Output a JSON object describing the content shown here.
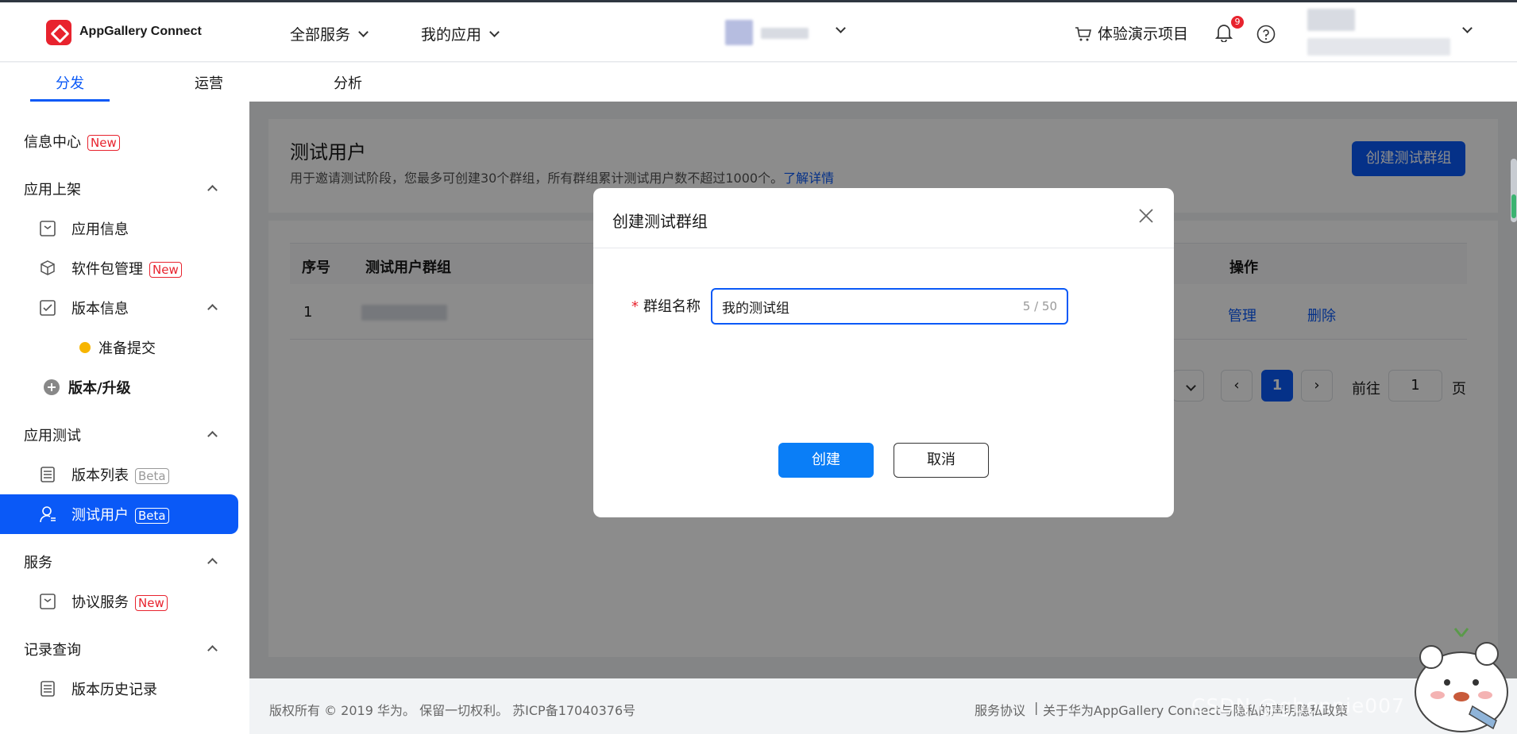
{
  "brand": {
    "name": "AppGallery Connect"
  },
  "topnav": {
    "all_services": "全部服务",
    "my_apps": "我的应用",
    "demo_project": "体验演示项目",
    "notification_count": "9"
  },
  "tabs": [
    {
      "label": "分发"
    },
    {
      "label": "运营"
    },
    {
      "label": "分析"
    }
  ],
  "sidebar": {
    "info_center": "信息中心",
    "info_center_tag": "New",
    "app_listing": "应用上架",
    "app_info": "应用信息",
    "package_mgmt": "软件包管理",
    "package_mgmt_tag": "New",
    "version_info": "版本信息",
    "ready_submit": "准备提交",
    "version_upgrade": "版本/升级",
    "app_test": "应用测试",
    "version_list": "版本列表",
    "version_list_tag": "Beta",
    "test_users": "测试用户",
    "test_users_tag": "Beta",
    "services": "服务",
    "agreement_service": "协议服务",
    "agreement_service_tag": "New",
    "records": "记录查询",
    "version_history": "版本历史记录"
  },
  "page": {
    "title": "测试用户",
    "description": "用于邀请测试阶段，您最多可创建30个群组，所有群组累计测试用户数不超过1000个。",
    "learn_more": "了解详情",
    "create_group_button": "创建测试群组"
  },
  "table": {
    "headers": {
      "index": "序号",
      "group": "测试用户群组",
      "actions": "操作"
    },
    "rows": [
      {
        "index": "1",
        "manage": "管理",
        "delete": "删除"
      }
    ]
  },
  "pagination": {
    "current_page": "1",
    "goto_label": "前往",
    "goto_value": "1",
    "page_unit": "页"
  },
  "footer": {
    "copyright": "版权所有 © 2019 华为。 保留一切权利。 苏ICP备17040376号",
    "terms": "服务协议",
    "about": "关于华为AppGallery Connect与隐私的声明",
    "privacy": "隐私政策",
    "watermark": "CSDN @gbonnie007"
  },
  "dialog": {
    "title": "创建测试群组",
    "field_label": "群组名称",
    "field_value": "我的测试组",
    "counter": "5 / 50",
    "create_button": "创建",
    "cancel_button": "取消"
  },
  "colors": {
    "primary": "#0a59f7",
    "danger": "#e8232e"
  }
}
